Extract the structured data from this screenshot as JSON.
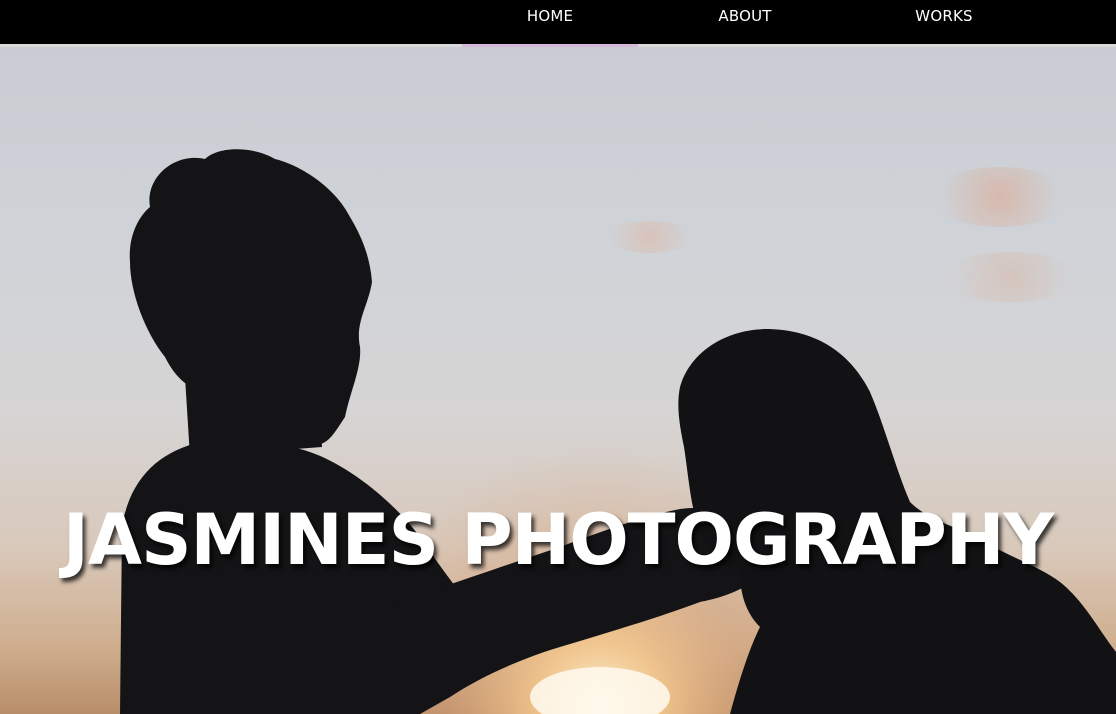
{
  "nav": {
    "items": [
      {
        "label": "HOME",
        "active": true
      },
      {
        "label": "ABOUT",
        "active": false
      },
      {
        "label": "WORKS",
        "active": false
      }
    ]
  },
  "hero": {
    "title": "JASMINES PHOTOGRAPHY",
    "image_subject": "silhouette of a couple at sunset"
  },
  "colors": {
    "nav_background": "#000000",
    "nav_text": "#ffffff",
    "active_indicator": "#d6b8d9",
    "title_text": "#ffffff"
  }
}
